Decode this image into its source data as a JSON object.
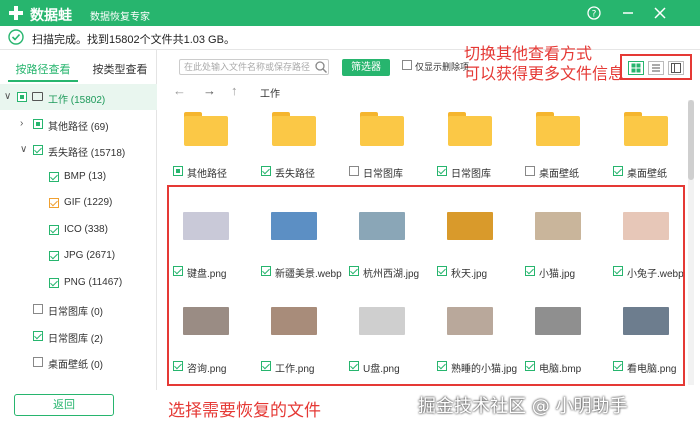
{
  "app": {
    "name": "数据蛙",
    "subtitle": "数据恢复专家",
    "help_icon": "help-icon",
    "minimize_icon": "minimize-icon",
    "close_icon": "close-icon",
    "brand_color": "#27b56e"
  },
  "status": {
    "text": "扫描完成。找到15802个文件共1.03 GB。"
  },
  "annotations": {
    "top": "切换其他查看方式\n可以获得更多文件信息",
    "bottom": "选择需要恢复的文件",
    "watermark": "掘金技术社区 @ 小明助手",
    "color": "#e53935"
  },
  "sidebar": {
    "tabs": [
      {
        "label": "按路径查看",
        "active": true
      },
      {
        "label": "按类型查看",
        "active": false
      }
    ],
    "tree": [
      {
        "label": "工作 (15802)",
        "arrow": "∨",
        "check": "partial",
        "selected": true
      },
      {
        "label": "其他路径 (69)",
        "arrow": "›",
        "check": "partial"
      },
      {
        "label": "丢失路径 (15718)",
        "arrow": "∨",
        "check": "checked"
      },
      {
        "label": "BMP (13)",
        "arrow": "",
        "check": "checked"
      },
      {
        "label": "GIF (1229)",
        "arrow": "",
        "check": "orange"
      },
      {
        "label": "ICO (338)",
        "arrow": "",
        "check": "checked"
      },
      {
        "label": "JPG (2671)",
        "arrow": "",
        "check": "checked"
      },
      {
        "label": "PNG (11467)",
        "arrow": "",
        "check": "checked"
      },
      {
        "label": "日常图库 (0)",
        "arrow": "",
        "check": "unchecked"
      },
      {
        "label": "日常图库 (2)",
        "arrow": "",
        "check": "checked"
      },
      {
        "label": "桌面壁纸 (0)",
        "arrow": "",
        "check": "unchecked"
      }
    ],
    "back_button": "返回"
  },
  "toolbar": {
    "search_placeholder": "在此处输入文件名称或保存路径",
    "filter_button": "筛选器",
    "show_deleted_label": "仅显示删除项",
    "views": [
      "grid-view-icon",
      "list-view-icon",
      "detail-view-icon"
    ]
  },
  "nav": {
    "back_icon": "←",
    "forward_icon": "→",
    "up_icon": "↑",
    "path": "工作"
  },
  "files": {
    "folders": [
      {
        "name": "其他路径",
        "check": "partial"
      },
      {
        "name": "丢失路径",
        "check": "checked"
      },
      {
        "name": "日常图库",
        "check": "unchecked"
      },
      {
        "name": "日常图库",
        "check": "checked"
      },
      {
        "name": "桌面壁纸",
        "check": "unchecked"
      },
      {
        "name": "桌面壁纸",
        "check": "checked"
      }
    ],
    "images_row1": [
      {
        "name": "键盘.png",
        "color": "#c9c9d8"
      },
      {
        "name": "新疆美景.webp",
        "color": "#5c8fc4"
      },
      {
        "name": "杭州西湖.jpg",
        "color": "#8aa6b7"
      },
      {
        "name": "秋天.jpg",
        "color": "#d99a2b"
      },
      {
        "name": "小猫.jpg",
        "color": "#c9b59b"
      },
      {
        "name": "小兔子.webp",
        "color": "#e7c7b8"
      }
    ],
    "images_row2": [
      {
        "name": "咨询.png",
        "color": "#9a8c84"
      },
      {
        "name": "工作.png",
        "color": "#a88c7a"
      },
      {
        "name": "U盘.png",
        "color": "#cfcfcf"
      },
      {
        "name": "熟睡的小猫.jpg",
        "color": "#b9a89b"
      },
      {
        "name": "电脑.bmp",
        "color": "#8f8f8f"
      },
      {
        "name": "看电脑.png",
        "color": "#6d7d8e"
      }
    ]
  }
}
